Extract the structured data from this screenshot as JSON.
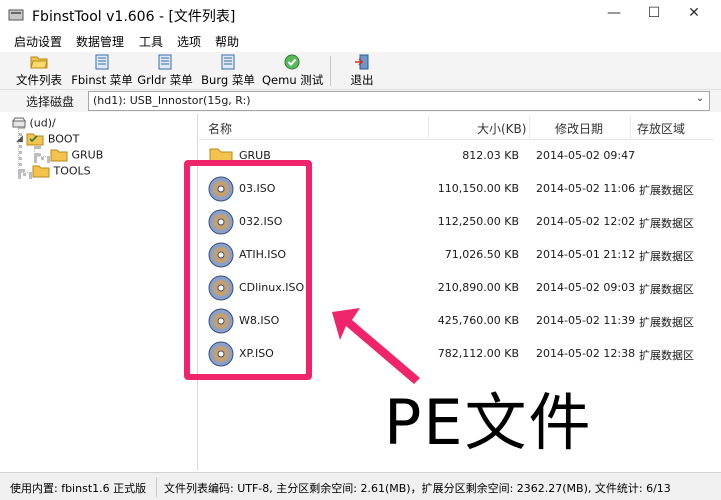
{
  "window": {
    "title": "FbinstTool v1.606 - [文件列表]"
  },
  "menu": [
    "启动设置",
    "数据管理",
    "工具",
    "选项",
    "帮助"
  ],
  "toolbar": {
    "file_list": "文件列表",
    "fbinst_menu": "Fbinst 菜单",
    "grldr_menu": "Grldr 菜单",
    "burg_menu": "Burg 菜单",
    "qemu_test": "Qemu 测试",
    "exit": "退出"
  },
  "disk": {
    "label": "选择磁盘",
    "selected": "(hd1): USB_Innostor(15g, R:)"
  },
  "tree": {
    "root": "(ud)/",
    "boot": "BOOT",
    "grub": "GRUB",
    "tools": "TOOLS"
  },
  "list": {
    "columns": {
      "name": "名称",
      "size": "大小(KB)",
      "date": "修改日期",
      "area": "存放区域"
    },
    "rows": [
      {
        "name": "GRUB",
        "size": "812.03 KB",
        "date": "2014-05-02 09:47",
        "area": "",
        "icon": "folder-icon"
      },
      {
        "name": "03.ISO",
        "size": "110,150.00 KB",
        "date": "2014-05-02 11:06",
        "area": "扩展数据区",
        "icon": "disc-icon"
      },
      {
        "name": "032.ISO",
        "size": "112,250.00 KB",
        "date": "2014-05-02 12:02",
        "area": "扩展数据区",
        "icon": "disc-icon"
      },
      {
        "name": "ATIH.ISO",
        "size": "71,026.50 KB",
        "date": "2014-05-01 21:12",
        "area": "扩展数据区",
        "icon": "disc-icon"
      },
      {
        "name": "CDlinux.ISO",
        "size": "210,890.00 KB",
        "date": "2014-05-02 09:03",
        "area": "扩展数据区",
        "icon": "disc-icon"
      },
      {
        "name": "W8.ISO",
        "size": "425,760.00 KB",
        "date": "2014-05-02 11:39",
        "area": "扩展数据区",
        "icon": "disc-icon"
      },
      {
        "name": "XP.ISO",
        "size": "782,112.00 KB",
        "date": "2014-05-02 12:38",
        "area": "扩展数据区",
        "icon": "disc-icon"
      }
    ]
  },
  "annotation": {
    "text": "PE文件",
    "color": "#f0246a"
  },
  "status": {
    "left": "使用内置: fbinst1.6 正式版",
    "right": "文件列表编码: UTF-8, 主分区剩余空间: 2.61(MB)，扩展分区剩余空间: 2362.27(MB), 文件统计: 6/13"
  }
}
